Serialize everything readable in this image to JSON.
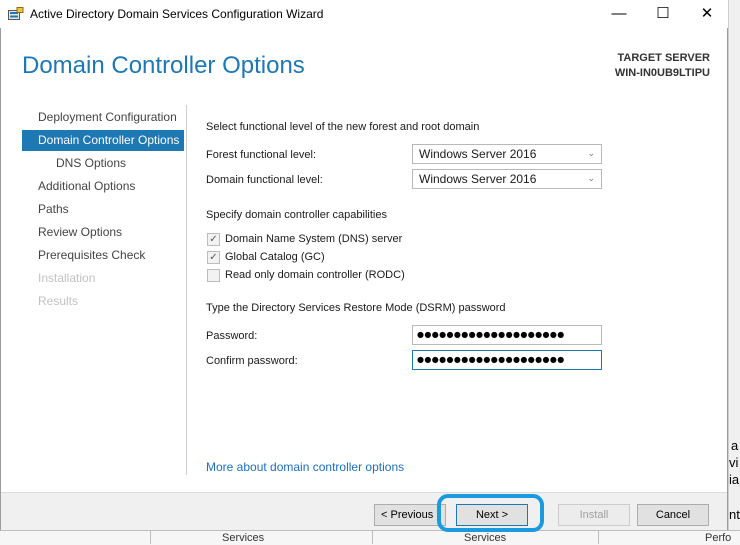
{
  "window": {
    "title": "Active Directory Domain Services Configuration Wizard",
    "minimize": "—",
    "maximize": "☐",
    "close": "✕"
  },
  "header": {
    "page_title": "Domain Controller Options",
    "target_label": "TARGET SERVER",
    "target_name": "WIN-IN0UB9LTIPU"
  },
  "nav": [
    {
      "label": "Deployment Configuration",
      "state": "normal"
    },
    {
      "label": "Domain Controller Options",
      "state": "active"
    },
    {
      "label": "DNS Options",
      "state": "sub"
    },
    {
      "label": "Additional Options",
      "state": "normal"
    },
    {
      "label": "Paths",
      "state": "normal"
    },
    {
      "label": "Review Options",
      "state": "normal"
    },
    {
      "label": "Prerequisites Check",
      "state": "normal"
    },
    {
      "label": "Installation",
      "state": "disabled"
    },
    {
      "label": "Results",
      "state": "disabled"
    }
  ],
  "content": {
    "functional_heading": "Select functional level of the new forest and root domain",
    "forest_label": "Forest functional level:",
    "forest_value": "Windows Server 2016",
    "domain_label": "Domain functional level:",
    "domain_value": "Windows Server 2016",
    "capabilities_heading": "Specify domain controller capabilities",
    "capabilities": [
      {
        "label": "Domain Name System (DNS) server",
        "checked": true
      },
      {
        "label": "Global Catalog (GC)",
        "checked": true
      },
      {
        "label": "Read only domain controller (RODC)",
        "checked": false
      }
    ],
    "dsrm_heading": "Type the Directory Services Restore Mode (DSRM) password",
    "password_label": "Password:",
    "password_value": "●●●●●●●●●●●●●●●●●●●●",
    "confirm_label": "Confirm password:",
    "confirm_value": "●●●●●●●●●●●●●●●●●●●●",
    "more_link": "More about domain controller options"
  },
  "footer": {
    "previous": "< Previous",
    "next": "Next >",
    "install": "Install",
    "cancel": "Cancel"
  },
  "background": {
    "right_fragments": [
      "a",
      "vi",
      "ia",
      "nt"
    ],
    "bottom_headers": [
      "Services",
      "Services",
      "Perfo"
    ]
  },
  "colors": {
    "accent": "#1e78b4",
    "highlight_ring": "#1a9be0",
    "link": "#1e6fb8"
  },
  "icons": {
    "app": "server-wizard-icon",
    "dropdown": "chevron-down-icon",
    "check": "checkmark-icon"
  }
}
